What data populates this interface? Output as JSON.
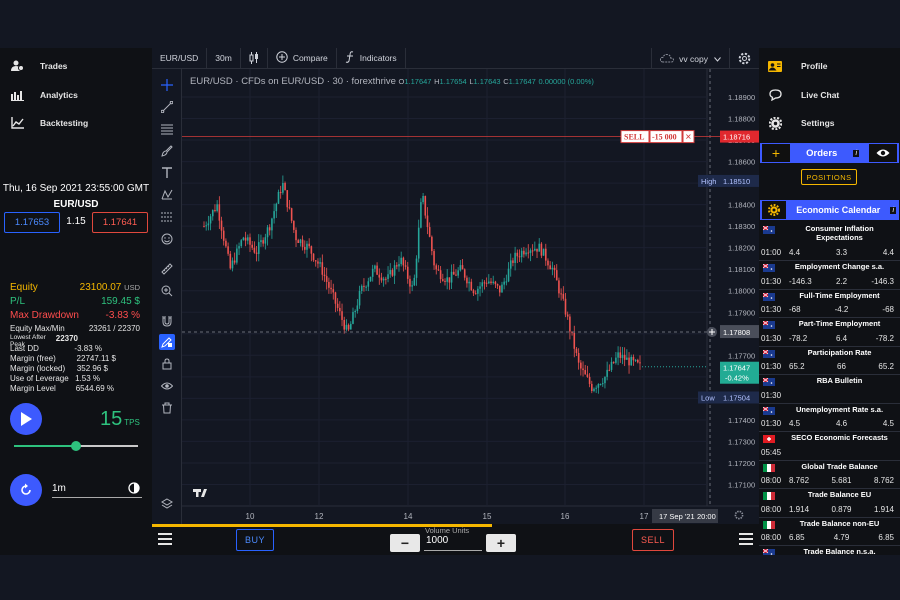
{
  "left": {
    "menu": [
      {
        "label": "Trades",
        "icon": "users-icon"
      },
      {
        "label": "Analytics",
        "icon": "analytics-icon"
      },
      {
        "label": "Backtesting",
        "icon": "backtesting-icon"
      }
    ],
    "datetime": "Thu, 16 Sep 2021 23:55:00 GMT",
    "pair": "EUR/USD",
    "bid": "1.17653",
    "spread": "1.15",
    "ask": "1.17641",
    "equity": {
      "label": "Equity",
      "value": "23100.07",
      "unit": "USD"
    },
    "pl": {
      "label": "P/L",
      "value": "159.45 $"
    },
    "max_drawdown": {
      "label": "Max Drawdown",
      "value": "-3.83 %"
    },
    "stats": [
      {
        "label": "Equity Max/Min",
        "value": "23261 / 22370"
      },
      {
        "label": "Lowest After Peak",
        "value": "22370"
      },
      {
        "label": "Last DD",
        "value": "-3.83 %"
      },
      {
        "label": "Margin (free)",
        "value": "22747.11 $"
      },
      {
        "label": "Margin (locked)",
        "value": "352.96 $"
      },
      {
        "label": "Use of Leverage",
        "value": "1.53 %"
      },
      {
        "label": "Margin Level",
        "value": "6544.69 %"
      }
    ],
    "tps_value": "15",
    "tps_unit": "TPS",
    "speed_fraction": 0.5,
    "interval": "1m"
  },
  "topbar": {
    "symbol": "EUR/USD",
    "interval": "30m",
    "compare": "Compare",
    "indicators": "Indicators",
    "layout": "vv copy"
  },
  "legend": {
    "title": "EUR/USD · CFDs on EUR/USD · 30 · forexthrive",
    "o_label": "O",
    "o": "1.17647",
    "h_label": "H",
    "h": "1.17654",
    "l_label": "L",
    "l": "1.17643",
    "c_label": "C",
    "c": "1.17647",
    "change": "0.00000 (0.00%)"
  },
  "order_line": {
    "side": "SELL",
    "qty": "-15 000",
    "close": "✕",
    "price": "1.18716"
  },
  "markers": {
    "high_label": "High",
    "high_price": "1.18510",
    "low_label": "Low",
    "low_price": "1.17504",
    "crosshair_price": "1.17808",
    "last_price": "1.17647",
    "last_change": "-0.42%",
    "date_tag": "17 Sep '21",
    "time_tag": "20:00"
  },
  "chart_data": {
    "type": "candlestick",
    "ylim": [
      1.17,
      1.1903
    ],
    "y_ticks": [
      "1.18900",
      "1.18800",
      "1.18700",
      "1.18600",
      "1.18500",
      "1.18400",
      "1.18300",
      "1.18200",
      "1.18100",
      "1.18000",
      "1.17900",
      "1.17800",
      "1.17700",
      "1.17600",
      "1.17500",
      "1.17400",
      "1.17300",
      "1.17200",
      "1.17100"
    ],
    "x_ticks": [
      "10",
      "12",
      "14",
      "15",
      "16",
      "17"
    ],
    "close_path": [
      {
        "t": 0.0,
        "p": 1.183
      },
      {
        "t": 0.03,
        "p": 1.184
      },
      {
        "t": 0.06,
        "p": 1.181
      },
      {
        "t": 0.09,
        "p": 1.1825
      },
      {
        "t": 0.12,
        "p": 1.1818
      },
      {
        "t": 0.15,
        "p": 1.183
      },
      {
        "t": 0.18,
        "p": 1.185
      },
      {
        "t": 0.21,
        "p": 1.1825
      },
      {
        "t": 0.24,
        "p": 1.182
      },
      {
        "t": 0.27,
        "p": 1.181
      },
      {
        "t": 0.3,
        "p": 1.1795
      },
      {
        "t": 0.33,
        "p": 1.178
      },
      {
        "t": 0.36,
        "p": 1.18
      },
      {
        "t": 0.39,
        "p": 1.181
      },
      {
        "t": 0.42,
        "p": 1.1805
      },
      {
        "t": 0.45,
        "p": 1.1815
      },
      {
        "t": 0.48,
        "p": 1.18
      },
      {
        "t": 0.5,
        "p": 1.1845
      },
      {
        "t": 0.53,
        "p": 1.181
      },
      {
        "t": 0.56,
        "p": 1.1805
      },
      {
        "t": 0.59,
        "p": 1.181
      },
      {
        "t": 0.62,
        "p": 1.18
      },
      {
        "t": 0.65,
        "p": 1.1805
      },
      {
        "t": 0.68,
        "p": 1.18
      },
      {
        "t": 0.71,
        "p": 1.1815
      },
      {
        "t": 0.74,
        "p": 1.182
      },
      {
        "t": 0.77,
        "p": 1.182
      },
      {
        "t": 0.8,
        "p": 1.181
      },
      {
        "t": 0.83,
        "p": 1.179
      },
      {
        "t": 0.86,
        "p": 1.1765
      },
      {
        "t": 0.89,
        "p": 1.1755
      },
      {
        "t": 0.92,
        "p": 1.176
      },
      {
        "t": 0.95,
        "p": 1.177
      },
      {
        "t": 1.0,
        "p": 1.17647
      }
    ]
  },
  "bottom": {
    "buy": "BUY",
    "sell": "SELL",
    "volume_label": "Volume Units",
    "volume": "1000",
    "minus": "−",
    "plus": "+",
    "progress_fraction": 0.56
  },
  "right": {
    "menu": [
      {
        "label": "Profile",
        "icon": "profile-icon"
      },
      {
        "label": "Live Chat",
        "icon": "chat-icon"
      },
      {
        "label": "Settings",
        "icon": "gear-icon"
      }
    ],
    "orders_title": "Orders",
    "info": "i",
    "positions": "POSITIONS",
    "calendar_title": "Economic Calendar",
    "events": [
      {
        "name": "Consumer Inflation Expectations",
        "time": "01:00",
        "actual": "4.4",
        "forecast": "3.3",
        "previous": "4.4",
        "flag": "au"
      },
      {
        "name": "Employment Change s.a.",
        "time": "01:30",
        "actual": "-146.3",
        "forecast": "2.2",
        "previous": "-146.3",
        "flag": "au"
      },
      {
        "name": "Full-Time Employment",
        "time": "01:30",
        "actual": "-68",
        "forecast": "-4.2",
        "previous": "-68",
        "flag": "au"
      },
      {
        "name": "Part-Time Employment",
        "time": "01:30",
        "actual": "-78.2",
        "forecast": "6.4",
        "previous": "-78.2",
        "flag": "au"
      },
      {
        "name": "Participation Rate",
        "time": "01:30",
        "actual": "65.2",
        "forecast": "66",
        "previous": "65.2",
        "flag": "au"
      },
      {
        "name": "RBA Bulletin",
        "time": "01:30",
        "actual": "",
        "forecast": "",
        "previous": "",
        "flag": "au"
      },
      {
        "name": "Unemployment Rate s.a.",
        "time": "01:30",
        "actual": "4.5",
        "forecast": "4.6",
        "previous": "4.5",
        "flag": "au"
      },
      {
        "name": "SECO Economic Forecasts",
        "time": "05:45",
        "actual": "",
        "forecast": "",
        "previous": "",
        "flag": "ch"
      },
      {
        "name": "Global Trade Balance",
        "time": "08:00",
        "actual": "8.762",
        "forecast": "5.681",
        "previous": "8.762",
        "flag": "it"
      },
      {
        "name": "Trade Balance EU",
        "time": "08:00",
        "actual": "1.914",
        "forecast": "0.879",
        "previous": "1.914",
        "flag": "it"
      },
      {
        "name": "Trade Balance non-EU",
        "time": "08:00",
        "actual": "6.85",
        "forecast": "4.79",
        "previous": "6.85",
        "flag": "it"
      },
      {
        "name": "Trade Balance n.s.a.",
        "time": "",
        "actual": "",
        "forecast": "",
        "previous": "",
        "flag": "au"
      }
    ]
  },
  "colors": {
    "up": "#26a69a",
    "down": "#ef5350",
    "accent": "#3d5afe",
    "gold": "#f5b700"
  }
}
